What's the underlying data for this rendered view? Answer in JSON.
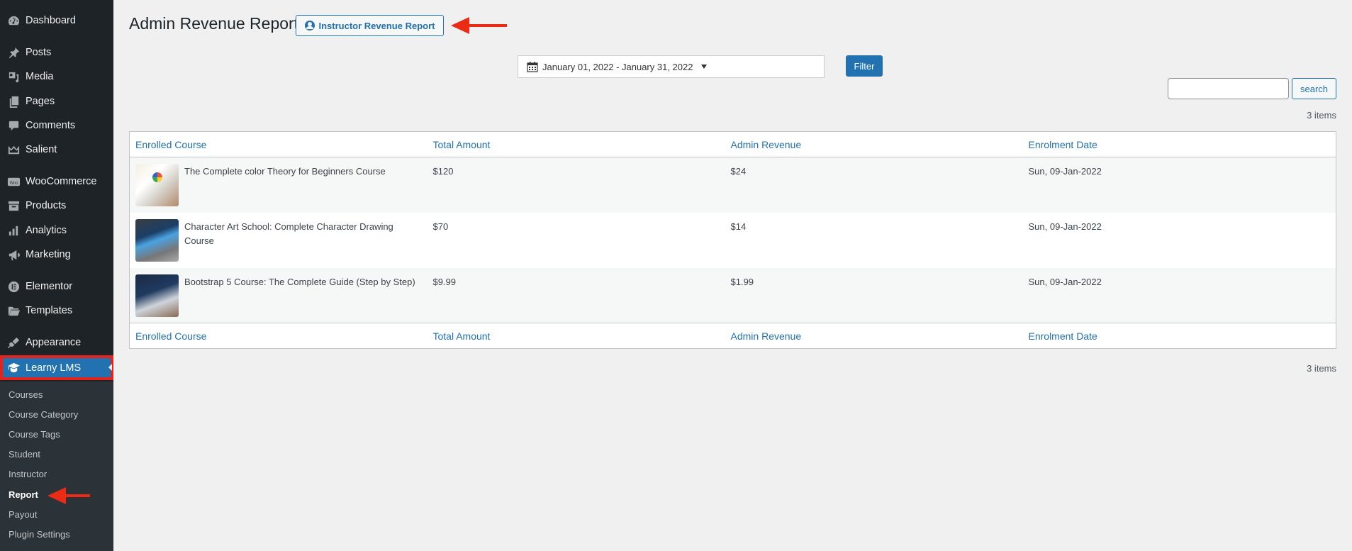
{
  "sidebar": {
    "items": [
      {
        "label": "Dashboard",
        "icon": "dashboard-icon"
      },
      {
        "label": "Posts",
        "icon": "pin-icon"
      },
      {
        "label": "Media",
        "icon": "media-icon"
      },
      {
        "label": "Pages",
        "icon": "pages-icon"
      },
      {
        "label": "Comments",
        "icon": "comment-icon"
      },
      {
        "label": "Salient",
        "icon": "crown-icon"
      },
      {
        "label": "WooCommerce",
        "icon": "woo-icon"
      },
      {
        "label": "Products",
        "icon": "archive-icon"
      },
      {
        "label": "Analytics",
        "icon": "bar-chart-icon"
      },
      {
        "label": "Marketing",
        "icon": "megaphone-icon"
      },
      {
        "label": "Elementor",
        "icon": "elementor-icon"
      },
      {
        "label": "Templates",
        "icon": "folder-icon"
      },
      {
        "label": "Appearance",
        "icon": "brush-icon"
      },
      {
        "label": "Learny LMS",
        "icon": "graduation-cap-icon",
        "current": true
      }
    ],
    "submenu": [
      {
        "label": "Courses"
      },
      {
        "label": "Course Category"
      },
      {
        "label": "Course Tags"
      },
      {
        "label": "Student"
      },
      {
        "label": "Instructor"
      },
      {
        "label": "Report",
        "active": true
      },
      {
        "label": "Payout"
      },
      {
        "label": "Plugin Settings"
      }
    ]
  },
  "header": {
    "title": "Admin Revenue Report",
    "instructor_button": "Instructor Revenue Report"
  },
  "filter": {
    "date_range": "January 01, 2022 - January 31, 2022",
    "filter_button": "Filter",
    "search_value": "",
    "search_button": "search"
  },
  "items_count": "3 items",
  "table": {
    "columns": [
      "Enrolled Course",
      "Total Amount",
      "Admin Revenue",
      "Enrolment Date"
    ],
    "rows": [
      {
        "course": "The Complete color Theory for Beginners Course",
        "total": "$120",
        "admin_revenue": "$24",
        "date": "Sun, 09-Jan-2022"
      },
      {
        "course": "Character Art School: Complete Character Drawing Course",
        "total": "$70",
        "admin_revenue": "$14",
        "date": "Sun, 09-Jan-2022"
      },
      {
        "course": "Bootstrap 5 Course: The Complete Guide (Step by Step)",
        "total": "$9.99",
        "admin_revenue": "$1.99",
        "date": "Sun, 09-Jan-2022"
      }
    ]
  },
  "colors": {
    "accent": "#2271b1",
    "sidebar_bg": "#1d2327",
    "annotation_red": "#ec2b15"
  }
}
